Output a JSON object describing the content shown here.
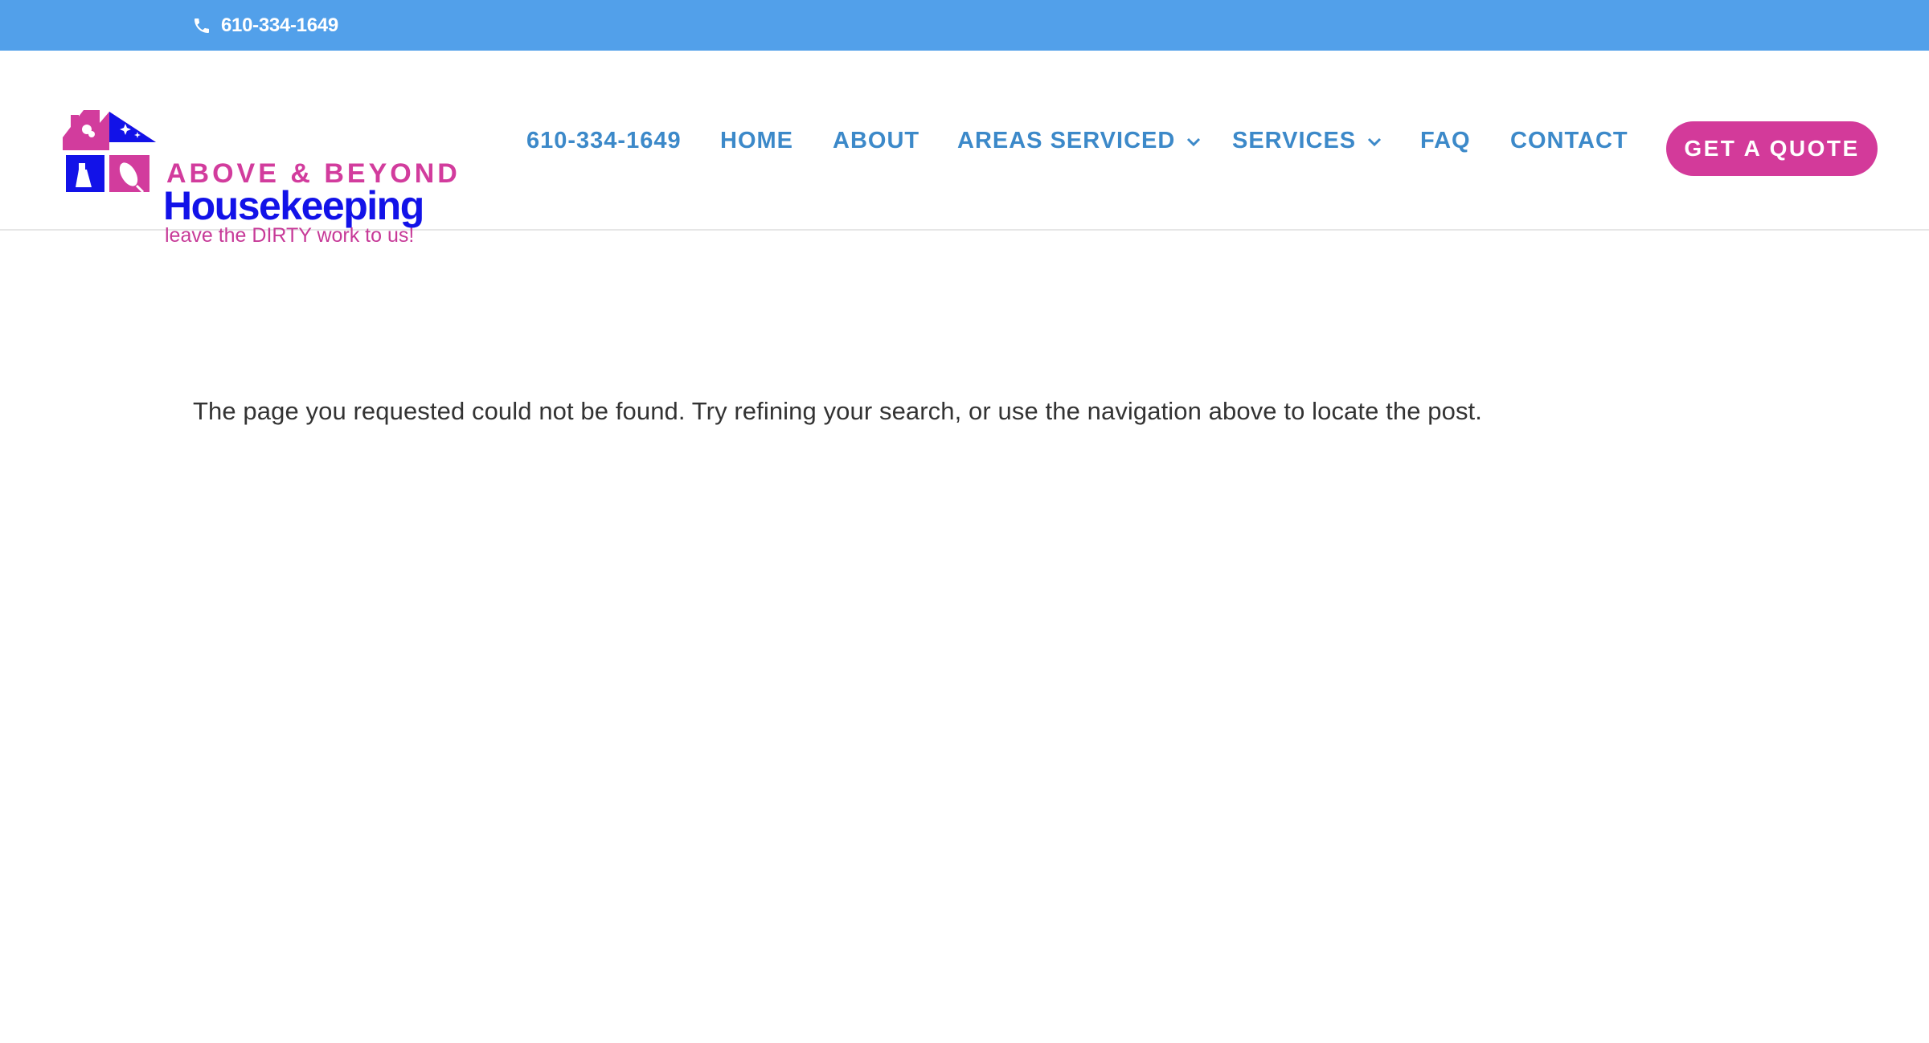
{
  "topbar": {
    "phone": "610-334-1649",
    "phone_icon": "phone-icon"
  },
  "logo": {
    "line1": "ABOVE & BEYOND",
    "line2": "Housekeeping",
    "tagline": "leave the DIRTY work to us!",
    "colors": {
      "pink": "#d23c9d",
      "blue": "#1212e8"
    }
  },
  "nav": {
    "items": [
      {
        "label": "610-334-1649"
      },
      {
        "label": "HOME"
      },
      {
        "label": "ABOUT"
      },
      {
        "label": "AREAS SERVICED",
        "icon": "chevron-down-icon"
      },
      {
        "label": "SERVICES",
        "icon": "chevron-down-icon"
      },
      {
        "label": "FAQ"
      },
      {
        "label": "CONTACT"
      }
    ],
    "cta_label": "GET A QUOTE"
  },
  "main": {
    "message": "The page you requested could not be found. Try refining your search, or use the navigation above to locate the post."
  },
  "colors": {
    "topbar": "#52a0ea",
    "nav_link": "#3c89c9",
    "cta": "#d33a9a"
  }
}
